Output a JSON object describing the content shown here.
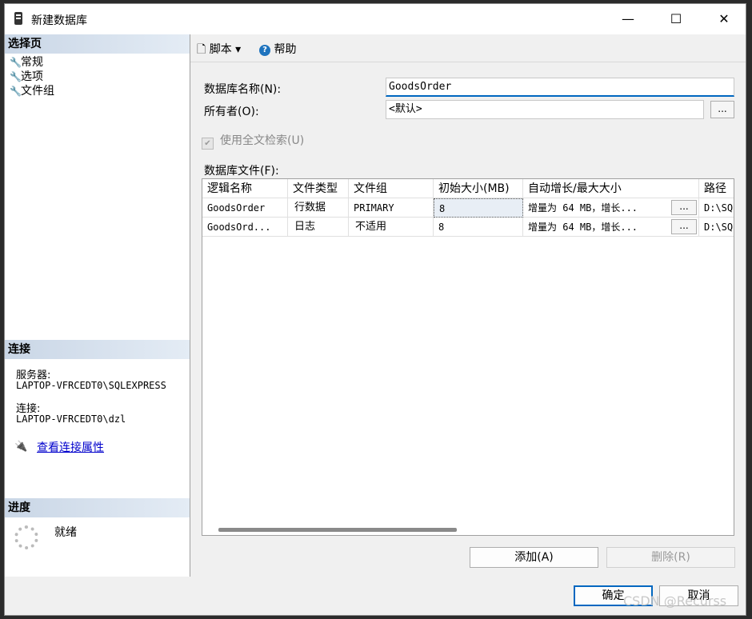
{
  "window": {
    "title": "新建数据库",
    "minimize_glyph": "—",
    "maximize_glyph": "☐",
    "close_glyph": "✕"
  },
  "sidebar": {
    "select_page_header": "选择页",
    "pages": [
      {
        "label": "常规",
        "icon": "wrench-icon"
      },
      {
        "label": "选项",
        "icon": "wrench-icon"
      },
      {
        "label": "文件组",
        "icon": "wrench-icon"
      }
    ],
    "connection_header": "连接",
    "server_label": "服务器:",
    "server_value": "LAPTOP-VFRCEDT0\\SQLEXPRESS",
    "connection_label": "连接:",
    "connection_value": "LAPTOP-VFRCEDT0\\dzl",
    "view_properties_link": "查看连接属性",
    "progress_header": "进度",
    "progress_status": "就绪"
  },
  "toolbar": {
    "script_label": "脚本",
    "help_label": "帮助"
  },
  "form": {
    "db_name_label": "数据库名称(N):",
    "db_name_value": "GoodsOrder",
    "owner_label": "所有者(O):",
    "owner_value": "<默认>",
    "browse_glyph": "...",
    "fulltext_label": "使用全文检索(U)",
    "fulltext_checked": true,
    "db_files_label": "数据库文件(F):"
  },
  "files_grid": {
    "headers": [
      "逻辑名称",
      "文件类型",
      "文件组",
      "初始大小(MB)",
      "自动增长/最大大小",
      "路径"
    ],
    "rows": [
      {
        "logical_name": "GoodsOrder",
        "file_type": "行数据",
        "filegroup": "PRIMARY",
        "initial_size": "8",
        "autogrowth": "增量为 64 MB，增长...",
        "path": "D:\\SQ"
      },
      {
        "logical_name": "GoodsOrd...",
        "file_type": "日志",
        "filegroup": "不适用",
        "initial_size": "8",
        "autogrowth": "增量为 64 MB，增长...",
        "path": "D:\\SQ"
      }
    ],
    "cell_button_glyph": "..."
  },
  "buttons": {
    "add": "添加(A)",
    "remove": "删除(R)",
    "ok": "确定",
    "cancel": "取消"
  },
  "watermark": "CSDN @Recurss"
}
